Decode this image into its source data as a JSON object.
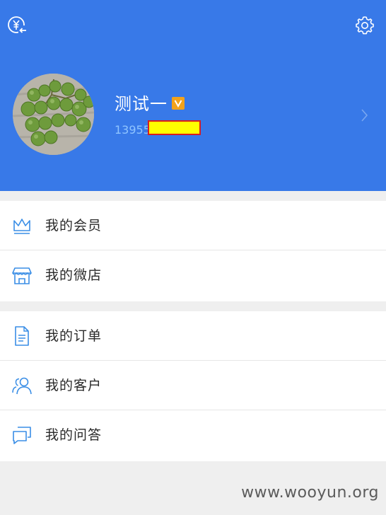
{
  "header": {
    "background_color": "#3879e8",
    "left_icon": "currency-exchange-icon",
    "right_icon": "gear-icon"
  },
  "profile": {
    "name": "测试一",
    "badge_letter": "V",
    "badge_color": "#f2a21b",
    "phone_visible": "13955",
    "phone_redacted": true
  },
  "menu": {
    "group1": [
      {
        "label": "我的会员",
        "icon": "crown-icon"
      },
      {
        "label": "我的微店",
        "icon": "store-icon"
      }
    ],
    "group2": [
      {
        "label": "我的订单",
        "icon": "document-icon"
      },
      {
        "label": "我的客户",
        "icon": "users-icon"
      },
      {
        "label": "我的问答",
        "icon": "chat-icon"
      }
    ],
    "icon_color": "#3a8ee6"
  },
  "watermark": "www.wooyun.org"
}
